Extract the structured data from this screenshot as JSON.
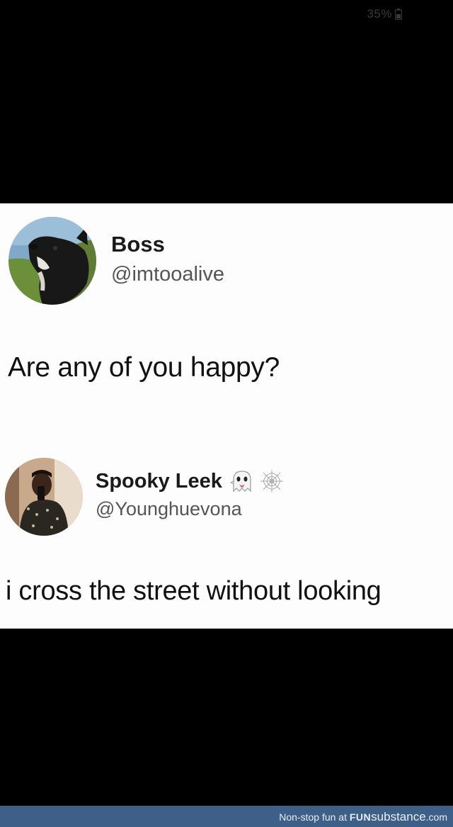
{
  "status_bar": {
    "battery_percent": "35%",
    "battery_icon": "battery-icon"
  },
  "tweets": [
    {
      "display_name": "Boss",
      "handle": "@imtooalive",
      "text": "Are any of you happy?",
      "avatar_icon": "dog-avatar"
    },
    {
      "display_name": "Spooky Leek",
      "name_emojis": [
        "ghost-icon",
        "spider-web-icon"
      ],
      "handle": "@Younghuevona",
      "text": "i cross the street without looking",
      "avatar_icon": "person-selfie-avatar"
    }
  ],
  "footer": {
    "tagline": "Non-stop fun at ",
    "brand_prefix": "FUN",
    "brand_main": "substance",
    "brand_suffix": ".com",
    "background_color": "#3e5f87"
  }
}
